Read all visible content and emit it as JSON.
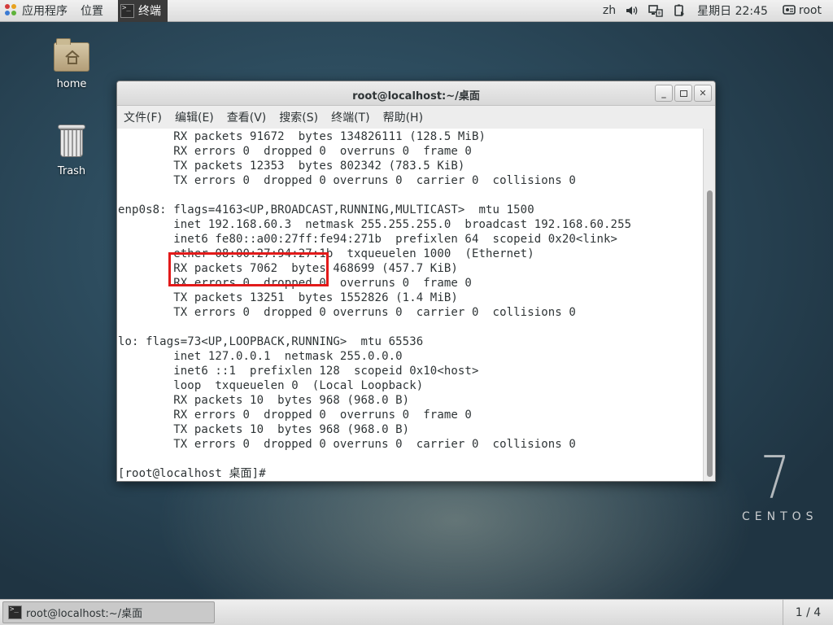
{
  "topbar": {
    "apps_label": "应用程序",
    "places_label": "位置",
    "task_label": "终端",
    "input_method": "zh",
    "clock": "星期日 22:45",
    "user": "root"
  },
  "desktop": {
    "home_label": "home",
    "trash_label": "Trash"
  },
  "terminal": {
    "title": "root@localhost:~/桌面",
    "menu": [
      "文件(F)",
      "编辑(E)",
      "查看(V)",
      "搜索(S)",
      "终端(T)",
      "帮助(H)"
    ],
    "lines": [
      "        RX packets 91672  bytes 134826111 (128.5 MiB)",
      "        RX errors 0  dropped 0  overruns 0  frame 0",
      "        TX packets 12353  bytes 802342 (783.5 KiB)",
      "        TX errors 0  dropped 0 overruns 0  carrier 0  collisions 0",
      "",
      "enp0s8: flags=4163<UP,BROADCAST,RUNNING,MULTICAST>  mtu 1500",
      "        inet 192.168.60.3  netmask 255.255.255.0  broadcast 192.168.60.255",
      "        inet6 fe80::a00:27ff:fe94:271b  prefixlen 64  scopeid 0x20<link>",
      "        ether 08:00:27:94:27:1b  txqueuelen 1000  (Ethernet)",
      "        RX packets 7062  bytes 468699 (457.7 KiB)",
      "        RX errors 0  dropped 0  overruns 0  frame 0",
      "        TX packets 13251  bytes 1552826 (1.4 MiB)",
      "        TX errors 0  dropped 0 overruns 0  carrier 0  collisions 0",
      "",
      "lo: flags=73<UP,LOOPBACK,RUNNING>  mtu 65536",
      "        inet 127.0.0.1  netmask 255.0.0.0",
      "        inet6 ::1  prefixlen 128  scopeid 0x10<host>",
      "        loop  txqueuelen 0  (Local Loopback)",
      "        RX packets 10  bytes 968 (968.0 B)",
      "        RX errors 0  dropped 0  overruns 0  frame 0",
      "        TX packets 10  bytes 968 (968.0 B)",
      "        TX errors 0  dropped 0 overruns 0  carrier 0  collisions 0",
      "",
      "[root@localhost 桌面]# "
    ]
  },
  "centos": {
    "version": "7",
    "word": "CENTOS"
  },
  "taskbar": {
    "window_label": "root@localhost:~/桌面",
    "workspace": "1 / 4"
  },
  "colors": {
    "highlight": "#e21a1a"
  }
}
